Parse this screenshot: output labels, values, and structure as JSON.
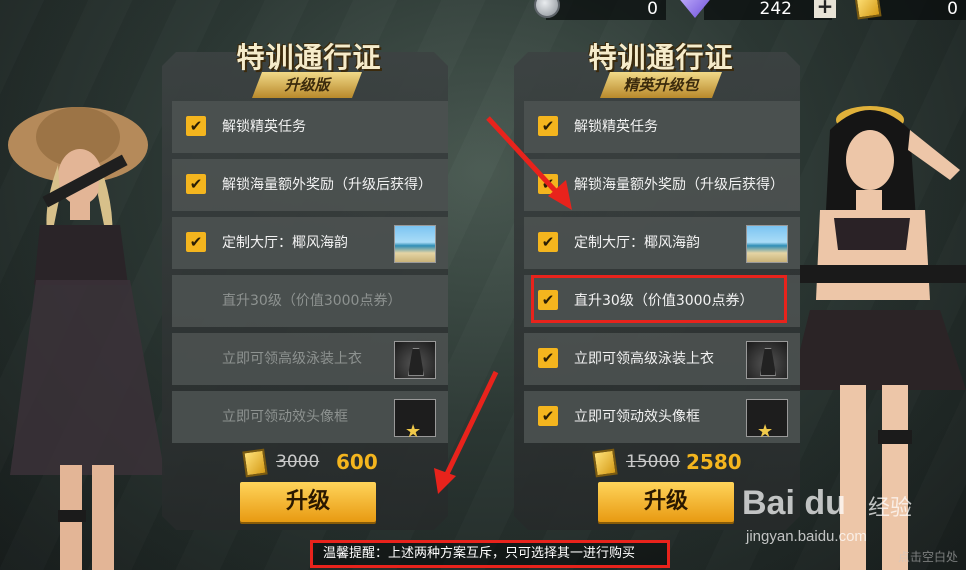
{
  "currency": {
    "coins": "0",
    "gems": "242",
    "plus": "+",
    "tickets": "0"
  },
  "left_panel": {
    "title": "特训通行证",
    "subtitle": "升级版",
    "items": [
      {
        "label": "解锁精英任务",
        "checked": true
      },
      {
        "label": "解锁海量额外奖励（升级后获得）",
        "checked": true
      },
      {
        "label": "定制大厅：椰风海韵",
        "checked": true,
        "thumb": "beach-thumbnail"
      },
      {
        "label": "直升30级（价值3000点券）",
        "checked": false
      },
      {
        "label": "立即可领高级泳装上衣",
        "checked": false,
        "thumb": "swimsuit-thumbnail"
      },
      {
        "label": "立即可领动效头像框",
        "checked": false,
        "thumb": "avatar-frame-thumbnail"
      }
    ],
    "old_price": "3000",
    "new_price": "600",
    "button": "升级"
  },
  "right_panel": {
    "title": "特训通行证",
    "subtitle": "精英升级包",
    "items": [
      {
        "label": "解锁精英任务",
        "checked": true
      },
      {
        "label": "解锁海量额外奖励（升级后获得）",
        "checked": true
      },
      {
        "label": "定制大厅：椰风海韵",
        "checked": true,
        "thumb": "beach-thumbnail"
      },
      {
        "label": "直升30级（价值3000点券）",
        "checked": true
      },
      {
        "label": "立即可领高级泳装上衣",
        "checked": true,
        "thumb": "swimsuit-thumbnail"
      },
      {
        "label": "立即可领动效头像框",
        "checked": true,
        "thumb": "avatar-frame-thumbnail"
      }
    ],
    "old_price": "15000",
    "new_price": "2580",
    "button": "升级"
  },
  "check_glyph": "✔",
  "notice": "温馨提醒：上述两种方案互斥，只可选择其一进行购买",
  "watermark": {
    "logo": "Bai du",
    "cn": "经验",
    "url": "jingyan.baidu.com"
  },
  "hint": "点击空白处",
  "colors": {
    "accent": "#f4b51e",
    "annotation_red": "#e8231c"
  }
}
